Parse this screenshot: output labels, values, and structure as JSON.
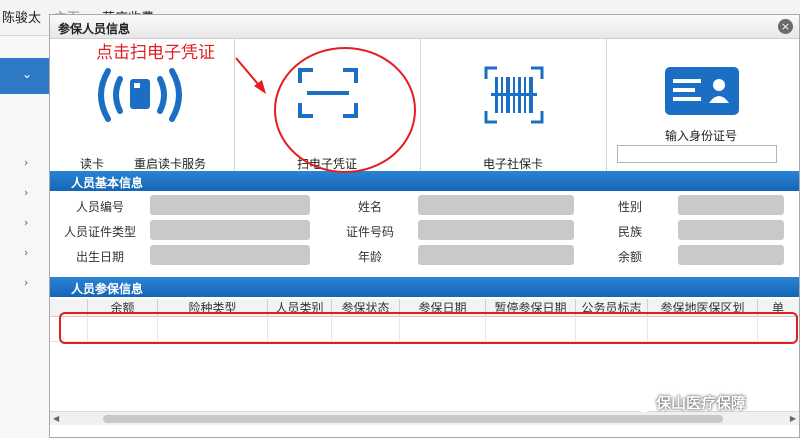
{
  "background": {
    "topbar_items": [
      "陈骏太",
      "主页",
      "药店收费"
    ],
    "sidebar_selected_icon": "chevron-down-icon"
  },
  "dialog": {
    "title": "参保人员信息",
    "close_label": "×"
  },
  "tiles": {
    "read_card": "读卡",
    "restart_service": "重启读卡服务",
    "scan_voucher": "扫电子凭证",
    "social_card": "电子社保卡",
    "id_input_label": "输入身份证号",
    "id_input_value": "",
    "icons": [
      "card-wave-icon",
      "scan-frame-icon",
      "barcode-scan-icon",
      "id-card-icon"
    ]
  },
  "basic_info": {
    "heading": "人员基本信息",
    "fields": [
      "人员编号",
      "姓名",
      "性别",
      "人员证件类型",
      "证件号码",
      "民族",
      "出生日期",
      "年龄",
      "余额"
    ]
  },
  "insurance": {
    "heading": "人员参保信息",
    "columns": [
      "余额",
      "险种类型",
      "人员类别",
      "参保状态",
      "参保日期",
      "暂停参保日期",
      "公务员标志",
      "参保地医保区划",
      "单"
    ]
  },
  "annotation": {
    "text": "点击扫电子凭证",
    "color": "#e21e1e"
  },
  "watermark": {
    "text": "保山医疗保障"
  },
  "colors": {
    "accent": "#1a6fc4",
    "section_header": "#1c6dbf",
    "field_placeholder": "#c9c9c9"
  }
}
